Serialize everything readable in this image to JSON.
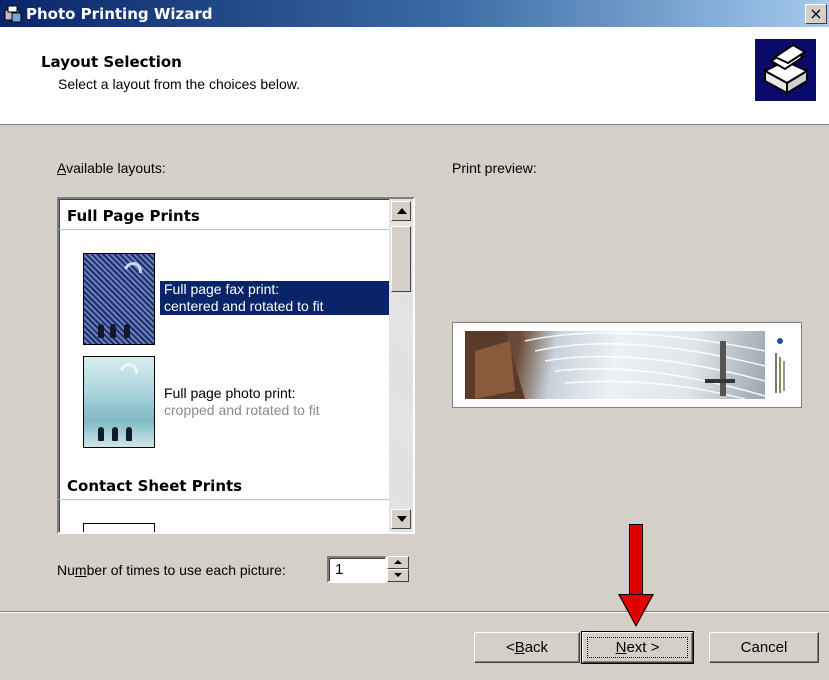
{
  "window": {
    "title": "Photo Printing Wizard",
    "close_symbol": "×",
    "icon": "photo-printer-icon"
  },
  "header": {
    "title": "Layout Selection",
    "subtitle": "Select a layout from the choices below.",
    "logo": "printer-logo-icon"
  },
  "layouts": {
    "label_prefix": "",
    "label_access": "A",
    "label_rest": "vailable layouts:",
    "groups": [
      {
        "title": "Full Page Prints"
      },
      {
        "title": "Contact Sheet Prints"
      }
    ],
    "items": [
      {
        "line1": "Full page fax print:",
        "line2": "centered and rotated to fit",
        "selected": true
      },
      {
        "line1": "Full page photo print:",
        "line2": "cropped and rotated to fit",
        "selected": false
      }
    ]
  },
  "preview": {
    "label": "Print preview:"
  },
  "copies": {
    "label_pre": "Nu",
    "label_access": "m",
    "label_rest": "ber of times to use each picture:",
    "value": "1"
  },
  "buttons": {
    "back_pre": "< ",
    "back_access": "B",
    "back_rest": "ack",
    "next_access": "N",
    "next_rest": "ext >",
    "cancel": "Cancel"
  },
  "colors": {
    "title_bar": "#0a246a",
    "selection": "#0a246a",
    "dialog_bg": "#d4d0c8",
    "annotation_arrow": "#e00000"
  }
}
